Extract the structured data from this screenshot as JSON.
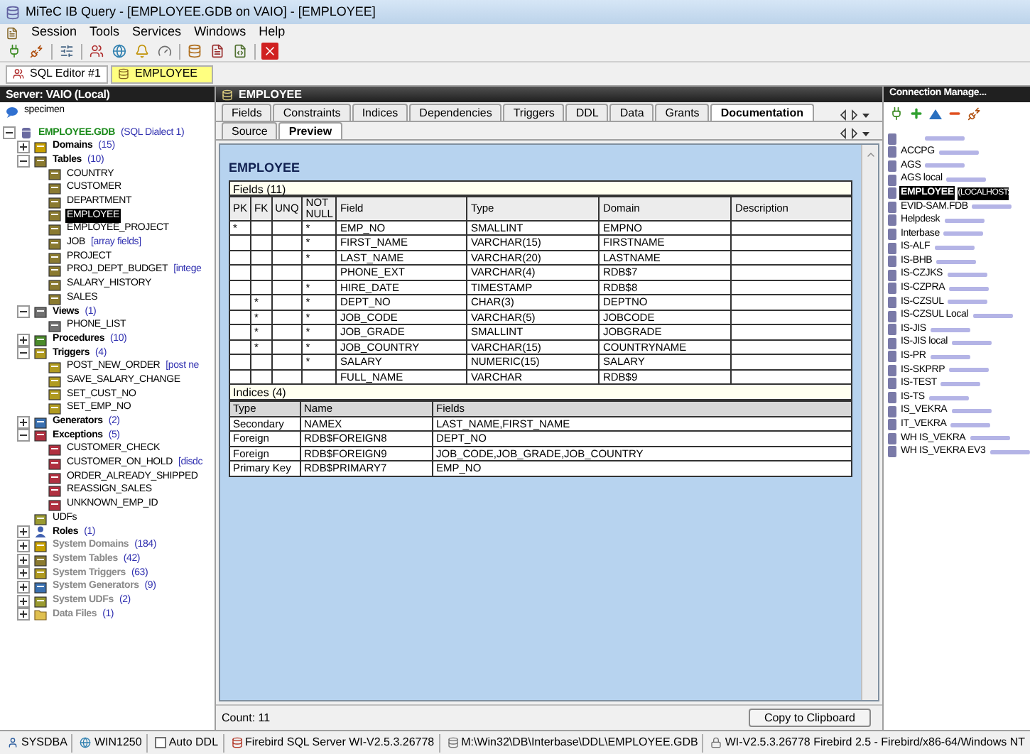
{
  "window": {
    "title": "MiTeC IB Query - [EMPLOYEE.GDB on VAIO] - [EMPLOYEE]"
  },
  "menu": [
    "Session",
    "Tools",
    "Services",
    "Windows",
    "Help"
  ],
  "doc_tabs": [
    {
      "label": "SQL Editor #1",
      "selected": false
    },
    {
      "label": "EMPLOYEE",
      "selected": true
    }
  ],
  "server_panel": {
    "title": "Server: VAIO (Local)",
    "server": "specimen",
    "tree": [
      {
        "label": "EMPLOYEE.GDB",
        "note": "(SQL Dialect 1)",
        "kind": "database",
        "expanded": true,
        "selected": false,
        "children": [
          {
            "label": "Domains",
            "note": "(15)",
            "kind": "domain",
            "expanded": false,
            "greyed": false,
            "selected": false
          },
          {
            "label": "Tables",
            "note": "(10)",
            "kind": "table",
            "expanded": true,
            "greyed": false,
            "selected": false,
            "children": [
              {
                "label": "COUNTRY",
                "kind": "table",
                "selected": false
              },
              {
                "label": "CUSTOMER",
                "kind": "table",
                "selected": false
              },
              {
                "label": "DEPARTMENT",
                "kind": "table",
                "selected": false
              },
              {
                "label": "EMPLOYEE",
                "kind": "table",
                "selected": true
              },
              {
                "label": "EMPLOYEE_PROJECT",
                "kind": "table",
                "selected": false
              },
              {
                "label": "JOB",
                "note": "[array fields]",
                "kind": "table",
                "selected": false
              },
              {
                "label": "PROJECT",
                "kind": "table",
                "selected": false
              },
              {
                "label": "PROJ_DEPT_BUDGET",
                "note": "[intege",
                "kind": "table",
                "selected": false
              },
              {
                "label": "SALARY_HISTORY",
                "kind": "table",
                "selected": false
              },
              {
                "label": "SALES",
                "kind": "table",
                "selected": false
              }
            ]
          },
          {
            "label": "Views",
            "note": "(1)",
            "kind": "view",
            "expanded": true,
            "greyed": false,
            "selected": false,
            "children": [
              {
                "label": "PHONE_LIST",
                "kind": "view",
                "selected": false
              }
            ]
          },
          {
            "label": "Procedures",
            "note": "(10)",
            "kind": "procedure",
            "expanded": false,
            "greyed": false,
            "selected": false
          },
          {
            "label": "Triggers",
            "note": "(4)",
            "kind": "trigger",
            "expanded": true,
            "greyed": false,
            "selected": false,
            "children": [
              {
                "label": "POST_NEW_ORDER",
                "note": "[post ne",
                "kind": "trigger",
                "selected": false
              },
              {
                "label": "SAVE_SALARY_CHANGE",
                "kind": "trigger",
                "selected": false
              },
              {
                "label": "SET_CUST_NO",
                "kind": "trigger",
                "selected": false
              },
              {
                "label": "SET_EMP_NO",
                "kind": "trigger",
                "selected": false
              }
            ]
          },
          {
            "label": "Generators",
            "note": "(2)",
            "kind": "generator",
            "expanded": false,
            "greyed": false,
            "selected": false
          },
          {
            "label": "Exceptions",
            "note": "(5)",
            "kind": "exception",
            "expanded": true,
            "greyed": false,
            "selected": false,
            "children": [
              {
                "label": "CUSTOMER_CHECK",
                "kind": "exception",
                "selected": false
              },
              {
                "label": "CUSTOMER_ON_HOLD",
                "note": "[disdc",
                "kind": "exception",
                "selected": false
              },
              {
                "label": "ORDER_ALREADY_SHIPPED",
                "kind": "exception",
                "selected": false
              },
              {
                "label": "REASSIGN_SALES",
                "kind": "exception",
                "selected": false
              },
              {
                "label": "UNKNOWN_EMP_ID",
                "kind": "exception",
                "selected": false
              }
            ]
          },
          {
            "label": "UDFs",
            "kind": "udf",
            "greyed": false,
            "selected": false
          },
          {
            "label": "Roles",
            "note": "(1)",
            "kind": "role",
            "expanded": false,
            "greyed": false,
            "selected": false
          },
          {
            "label": "System Domains",
            "note": "(184)",
            "kind": "domain",
            "expanded": false,
            "greyed": true,
            "selected": false
          },
          {
            "label": "System Tables",
            "note": "(42)",
            "kind": "table",
            "expanded": false,
            "greyed": true,
            "selected": false
          },
          {
            "label": "System Triggers",
            "note": "(63)",
            "kind": "trigger",
            "expanded": false,
            "greyed": true,
            "selected": false
          },
          {
            "label": "System Generators",
            "note": "(9)",
            "kind": "generator",
            "expanded": false,
            "greyed": true,
            "selected": false
          },
          {
            "label": "System UDFs",
            "note": "(2)",
            "kind": "udf",
            "expanded": false,
            "greyed": true,
            "selected": false
          },
          {
            "label": "Data Files",
            "note": "(1)",
            "kind": "folder",
            "expanded": false,
            "greyed": true,
            "selected": false
          }
        ]
      }
    ]
  },
  "object_panel": {
    "title": "EMPLOYEE",
    "tabs": [
      {
        "label": "Fields",
        "selected": false
      },
      {
        "label": "Constraints",
        "selected": false
      },
      {
        "label": "Indices",
        "selected": false
      },
      {
        "label": "Dependencies",
        "selected": false
      },
      {
        "label": "Triggers",
        "selected": false
      },
      {
        "label": "DDL",
        "selected": false
      },
      {
        "label": "Data",
        "selected": false
      },
      {
        "label": "Grants",
        "selected": false
      },
      {
        "label": "Documentation",
        "selected": true
      }
    ],
    "subtabs": [
      {
        "label": "Source",
        "selected": false
      },
      {
        "label": "Preview",
        "selected": true
      }
    ],
    "document": {
      "heading": "EMPLOYEE",
      "fields": {
        "caption": "Fields (11)",
        "columns": [
          "PK",
          "FK",
          "UNQ",
          "NOT NULL",
          "Field",
          "Type",
          "Domain",
          "Description"
        ],
        "rows": [
          {
            "pk": "*",
            "not_null": "*",
            "field": "EMP_NO",
            "type": "SMALLINT",
            "domain": "EMPNO"
          },
          {
            "not_null": "*",
            "field": "FIRST_NAME",
            "type": "VARCHAR(15)",
            "domain": "FIRSTNAME"
          },
          {
            "not_null": "*",
            "field": "LAST_NAME",
            "type": "VARCHAR(20)",
            "domain": "LASTNAME"
          },
          {
            "field": "PHONE_EXT",
            "type": "VARCHAR(4)",
            "domain": "RDB$7"
          },
          {
            "not_null": "*",
            "field": "HIRE_DATE",
            "type": "TIMESTAMP",
            "domain": "RDB$8"
          },
          {
            "fk": "*",
            "not_null": "*",
            "field": "DEPT_NO",
            "type": "CHAR(3)",
            "domain": "DEPTNO"
          },
          {
            "fk": "*",
            "not_null": "*",
            "field": "JOB_CODE",
            "type": "VARCHAR(5)",
            "domain": "JOBCODE"
          },
          {
            "fk": "*",
            "not_null": "*",
            "field": "JOB_GRADE",
            "type": "SMALLINT",
            "domain": "JOBGRADE"
          },
          {
            "fk": "*",
            "not_null": "*",
            "field": "JOB_COUNTRY",
            "type": "VARCHAR(15)",
            "domain": "COUNTRYNAME"
          },
          {
            "not_null": "*",
            "field": "SALARY",
            "type": "NUMERIC(15)",
            "domain": "SALARY"
          },
          {
            "field": "FULL_NAME",
            "type": "VARCHAR",
            "domain": "RDB$9"
          }
        ]
      },
      "indices": {
        "caption": "Indices (4)",
        "columns": [
          "Type",
          "Name",
          "Fields"
        ],
        "rows": [
          [
            "Secondary",
            "NAMEX",
            "LAST_NAME,FIRST_NAME"
          ],
          [
            "Foreign",
            "RDB$FOREIGN8",
            "DEPT_NO"
          ],
          [
            "Foreign",
            "RDB$FOREIGN9",
            "JOB_CODE,JOB_GRADE,JOB_COUNTRY"
          ],
          [
            "Primary Key",
            "RDB$PRIMARY7",
            "EMP_NO"
          ]
        ]
      }
    },
    "count": "Count: 11",
    "copy_button": "Copy to Clipboard"
  },
  "connection_panel": {
    "title": "Connection Manage...",
    "connections": [
      {
        "selected": false
      },
      {
        "label": "ACCPG",
        "selected": false
      },
      {
        "label": "AGS",
        "selected": false
      },
      {
        "label": "AGS local",
        "selected": false
      },
      {
        "label": "EMPLOYEE",
        "detail": "(LOCALHOST:",
        "selected": true
      },
      {
        "label": "EVID-SAM.FDB",
        "selected": false
      },
      {
        "label": "Helpdesk",
        "selected": false
      },
      {
        "label": "Interbase",
        "selected": false
      },
      {
        "label": "IS-ALF",
        "selected": false
      },
      {
        "label": "IS-BHB",
        "selected": false
      },
      {
        "label": "IS-CZJKS",
        "selected": false
      },
      {
        "label": "IS-CZPRA",
        "selected": false
      },
      {
        "label": "IS-CZSUL",
        "selected": false
      },
      {
        "label": "IS-CZSUL Local",
        "selected": false
      },
      {
        "label": "IS-JIS",
        "selected": false
      },
      {
        "label": "IS-JIS local",
        "selected": false
      },
      {
        "label": "IS-PR",
        "selected": false
      },
      {
        "label": "IS-SKPRP",
        "selected": false
      },
      {
        "label": "IS-TEST",
        "selected": false
      },
      {
        "label": "IS-TS",
        "selected": false
      },
      {
        "label": "IS_VEKRA",
        "selected": false
      },
      {
        "label": "IT_VEKRA",
        "selected": false
      },
      {
        "label": "WH IS_VEKRA",
        "selected": false
      },
      {
        "label": "WH IS_VEKRA EV3",
        "selected": false
      }
    ]
  },
  "status_bar": [
    {
      "kind": "text",
      "text": "SYSDBA"
    },
    {
      "kind": "text",
      "text": "WIN1250"
    },
    {
      "kind": "checkbox",
      "text": "Auto DDL",
      "checked": false
    },
    {
      "kind": "text",
      "text": "Firebird SQL Server WI-V2.5.3.26778"
    },
    {
      "kind": "text",
      "text": "M:\\Win32\\DB\\Interbase\\DDL\\EMPLOYEE.GDB"
    },
    {
      "kind": "text",
      "text": "WI-V2.5.3.26778 Firebird 2.5 - Firebird/x86-64/Windows NT"
    }
  ]
}
